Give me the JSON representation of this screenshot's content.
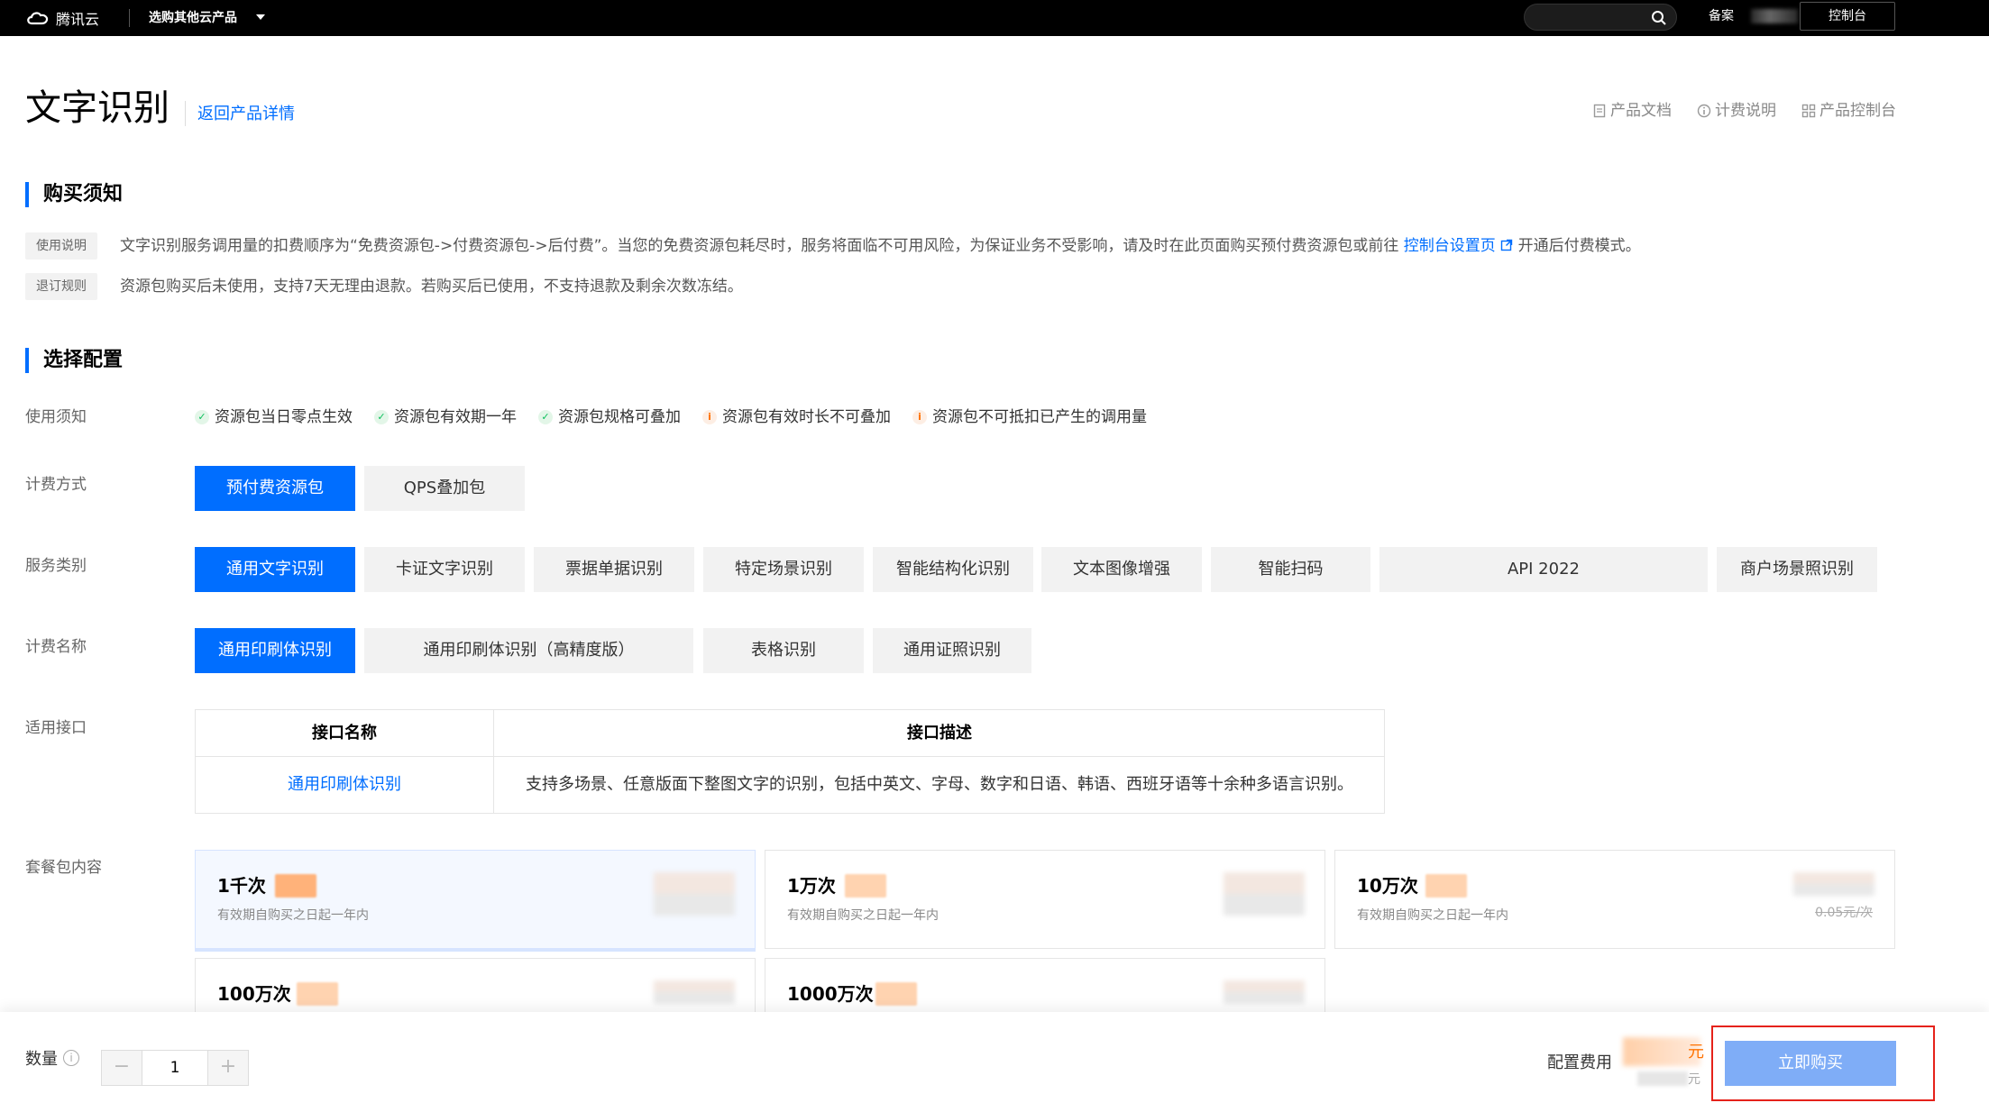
{
  "topbar": {
    "brand": "腾讯云",
    "products": "选购其他云产品",
    "beian": "备案",
    "console": "控制台"
  },
  "header": {
    "title": "文字识别",
    "back_link": "返回产品详情",
    "links": [
      "产品文档",
      "计费说明",
      "产品控制台"
    ]
  },
  "notice": {
    "section_title": "购买须知",
    "usage_tag": "使用说明",
    "usage_text": "文字识别服务调用量的扣费顺序为“免费资源包->付费资源包->后付费”。当您的免费资源包耗尽时，服务将面临不可用风险，为保证业务不受影响，请及时在此页面购买预付费资源包或前往",
    "usage_link": "控制台设置页",
    "usage_after": "开通后付费模式。",
    "refund_tag": "退订规则",
    "refund_text": "资源包购买后未使用，支持7天无理由退款。若购买后已使用，不支持退款及剩余次数冻结。"
  },
  "config": {
    "section_title": "选择配置",
    "labels": {
      "usage": "使用须知",
      "billing": "计费方式",
      "service": "服务类别",
      "billing_name": "计费名称",
      "api": "适用接口",
      "package": "套餐包内容"
    },
    "checks": [
      {
        "text": "资源包当日零点生效",
        "type": "ok"
      },
      {
        "text": "资源包有效期一年",
        "type": "ok"
      },
      {
        "text": "资源包规格可叠加",
        "type": "ok"
      },
      {
        "text": "资源包有效时长不可叠加",
        "type": "warn"
      },
      {
        "text": "资源包不可抵扣已产生的调用量",
        "type": "warn"
      }
    ],
    "billing_options": [
      "预付费资源包",
      "QPS叠加包"
    ],
    "service_options": [
      "通用文字识别",
      "卡证文字识别",
      "票据单据识别",
      "特定场景识别",
      "智能结构化识别",
      "文本图像增强",
      "智能扫码",
      "API 2022",
      "商户场景照识别"
    ],
    "billing_name_options": [
      "通用印刷体识别",
      "通用印刷体识别（高精度版）",
      "表格识别",
      "通用证照识别"
    ],
    "api_table": {
      "headers": [
        "接口名称",
        "接口描述"
      ],
      "row": [
        "通用印刷体识别",
        "支持多场景、任意版面下整图文字的识别，包括中英文、字母、数字和日语、韩语、西班牙语等十余种多语言识别。"
      ]
    },
    "packages": [
      {
        "name": "1千次",
        "desc": "有效期自购买之日起一年内"
      },
      {
        "name": "1万次",
        "desc": "有效期自购买之日起一年内"
      },
      {
        "name": "10万次",
        "desc": "有效期自购买之日起一年内",
        "unit": "0.05元/次"
      },
      {
        "name": "100万次"
      },
      {
        "name": "1000万次"
      }
    ]
  },
  "footer": {
    "qty_label": "数量",
    "qty_value": "1",
    "fee_label": "配置费用",
    "yuan": "元",
    "buy": "立即购买"
  }
}
